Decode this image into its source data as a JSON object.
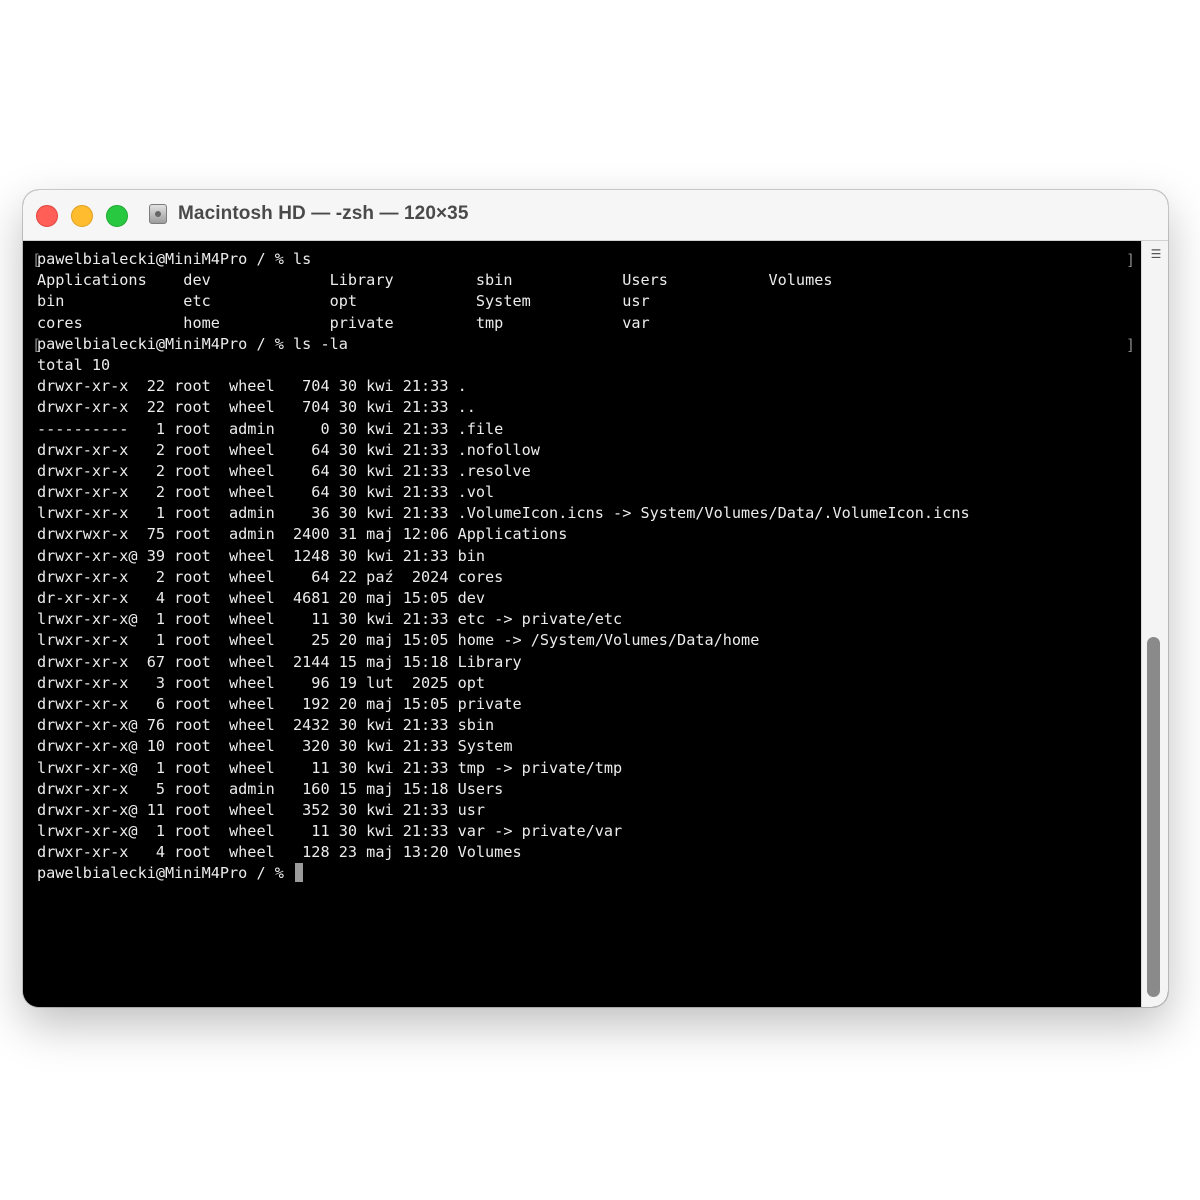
{
  "window": {
    "title": "Macintosh HD — -zsh — 120×35",
    "buttons": {
      "close": "close",
      "minimize": "minimize",
      "zoom": "zoom"
    }
  },
  "terminal": {
    "cursor": "block",
    "lines": [
      "pawelbialecki@MiniM4Pro / % ls",
      "Applications    dev             Library         sbin            Users           Volumes",
      "bin             etc             opt             System          usr",
      "cores           home            private         tmp             var",
      "pawelbialecki@MiniM4Pro / % ls -la",
      "total 10",
      "drwxr-xr-x  22 root  wheel   704 30 kwi 21:33 .",
      "drwxr-xr-x  22 root  wheel   704 30 kwi 21:33 ..",
      "----------   1 root  admin     0 30 kwi 21:33 .file",
      "drwxr-xr-x   2 root  wheel    64 30 kwi 21:33 .nofollow",
      "drwxr-xr-x   2 root  wheel    64 30 kwi 21:33 .resolve",
      "drwxr-xr-x   2 root  wheel    64 30 kwi 21:33 .vol",
      "lrwxr-xr-x   1 root  admin    36 30 kwi 21:33 .VolumeIcon.icns -> System/Volumes/Data/.VolumeIcon.icns",
      "drwxrwxr-x  75 root  admin  2400 31 maj 12:06 Applications",
      "drwxr-xr-x@ 39 root  wheel  1248 30 kwi 21:33 bin",
      "drwxr-xr-x   2 root  wheel    64 22 paź  2024 cores",
      "dr-xr-xr-x   4 root  wheel  4681 20 maj 15:05 dev",
      "lrwxr-xr-x@  1 root  wheel    11 30 kwi 21:33 etc -> private/etc",
      "lrwxr-xr-x   1 root  wheel    25 20 maj 15:05 home -> /System/Volumes/Data/home",
      "drwxr-xr-x  67 root  wheel  2144 15 maj 15:18 Library",
      "drwxr-xr-x   3 root  wheel    96 19 lut  2025 opt",
      "drwxr-xr-x   6 root  wheel   192 20 maj 15:05 private",
      "drwxr-xr-x@ 76 root  wheel  2432 30 kwi 21:33 sbin",
      "drwxr-xr-x@ 10 root  wheel   320 30 kwi 21:33 System",
      "lrwxr-xr-x@  1 root  wheel    11 30 kwi 21:33 tmp -> private/tmp",
      "drwxr-xr-x   5 root  admin   160 15 maj 15:18 Users",
      "drwxr-xr-x@ 11 root  wheel   352 30 kwi 21:33 usr",
      "lrwxr-xr-x@  1 root  wheel    11 30 kwi 21:33 var -> private/var",
      "drwxr-xr-x   4 root  wheel   128 23 maj 13:20 Volumes",
      "pawelbialecki@MiniM4Pro / % "
    ]
  },
  "icons": {
    "disk": "hard-disk-icon",
    "scroll": "scroll-menu-icon"
  },
  "colors": {
    "background": "#000000",
    "text": "#ececec",
    "cursor": "#9b9b9b",
    "close": "#ff5f57",
    "minimize": "#febc2e",
    "zoom": "#28c840"
  }
}
